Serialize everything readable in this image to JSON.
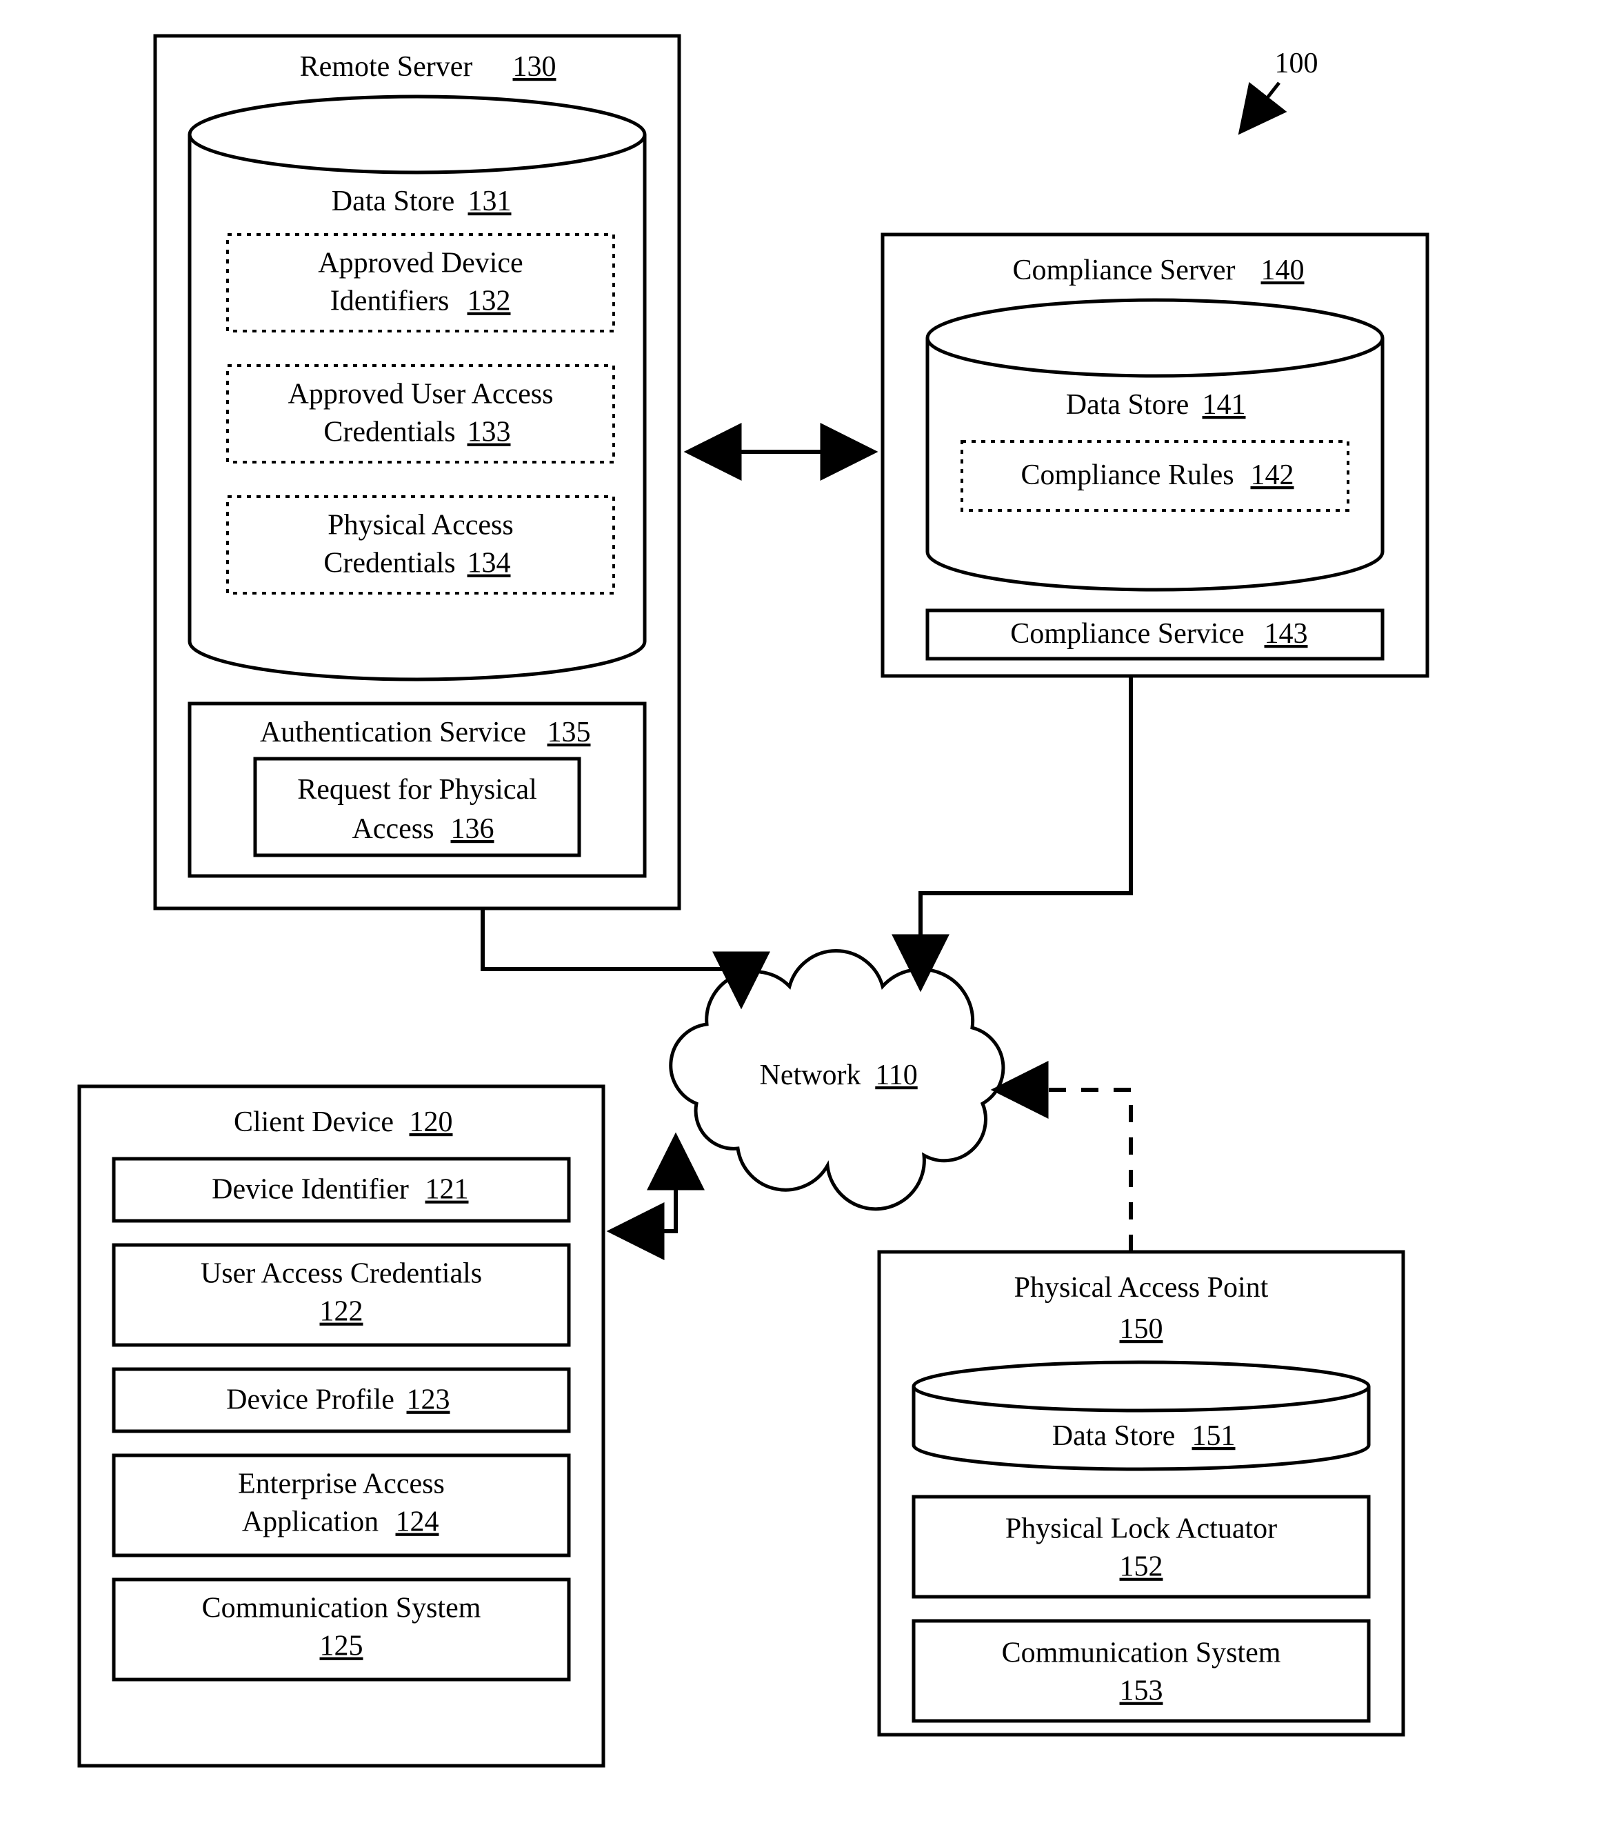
{
  "figure_ref": {
    "label": "100"
  },
  "remote_server": {
    "title": "Remote Server",
    "ref": "130",
    "data_store": {
      "title": "Data Store",
      "ref": "131",
      "items": [
        {
          "l1": "Approved Device",
          "l2": "Identifiers",
          "ref": "132"
        },
        {
          "l1": "Approved User Access",
          "l2": "Credentials",
          "ref": "133"
        },
        {
          "l1": "Physical Access",
          "l2": "Credentials",
          "ref": "134"
        }
      ]
    },
    "auth_service": {
      "title": "Authentication Service",
      "ref": "135",
      "request": {
        "l1": "Request for Physical",
        "l2": "Access",
        "ref": "136"
      }
    }
  },
  "compliance_server": {
    "title": "Compliance Server",
    "ref": "140",
    "data_store": {
      "title": "Data Store",
      "ref": "141",
      "rules": {
        "title": "Compliance Rules",
        "ref": "142"
      }
    },
    "service": {
      "title": "Compliance Service",
      "ref": "143"
    }
  },
  "network": {
    "title": "Network",
    "ref": "110"
  },
  "client_device": {
    "title": "Client Device",
    "ref": "120",
    "items": [
      {
        "l1": "Device Identifier",
        "l2": "",
        "ref": "121"
      },
      {
        "l1": "User Access Credentials",
        "l2": "",
        "ref": "122",
        "refbelow": true
      },
      {
        "l1": "Device Profile",
        "l2": "",
        "ref": "123"
      },
      {
        "l1": "Enterprise Access",
        "l2": "Application",
        "ref": "124"
      },
      {
        "l1": "Communication System",
        "l2": "",
        "ref": "125",
        "refbelow": true
      }
    ]
  },
  "pap": {
    "title": "Physical Access Point",
    "ref": "150",
    "data_store": {
      "title": "Data Store",
      "ref": "151"
    },
    "items": [
      {
        "l1": "Physical Lock Actuator",
        "ref": "152"
      },
      {
        "l1": "Communication System",
        "ref": "153"
      }
    ]
  }
}
